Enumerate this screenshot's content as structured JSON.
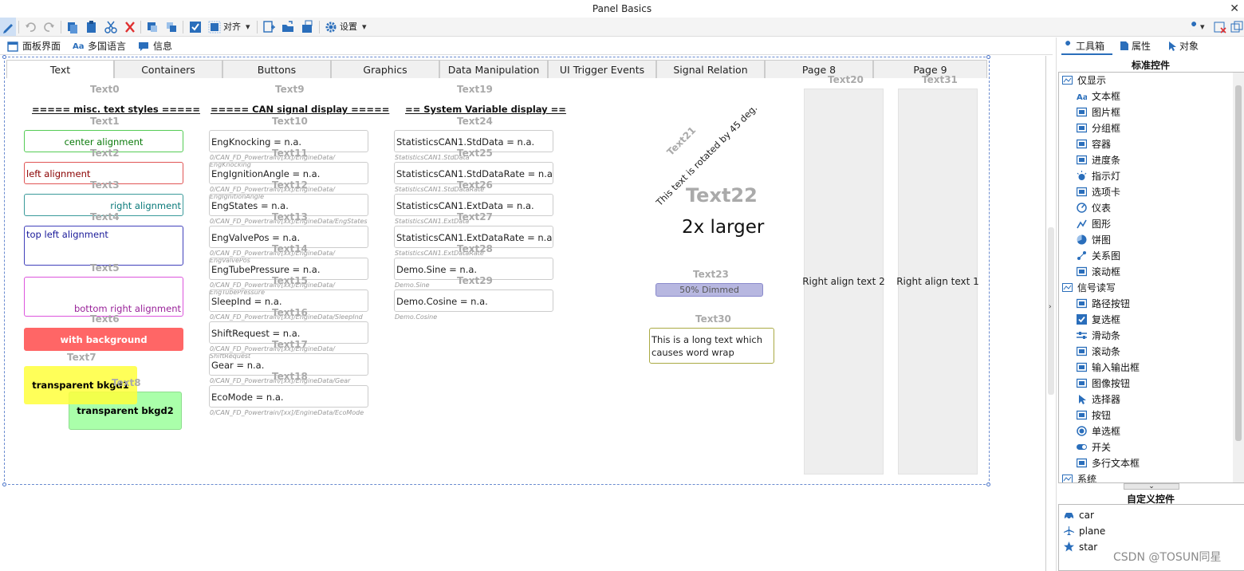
{
  "window": {
    "title": "Panel Basics",
    "close": "✕"
  },
  "toolbar": {
    "align_label": "对齐",
    "settings_label": "设置"
  },
  "panel_tabs": [
    "面板界面",
    "多国语言",
    "信息"
  ],
  "tabs": [
    "Text",
    "Containers",
    "Buttons",
    "Graphics",
    "Data Manipulation",
    "UI Trigger Events",
    "Signal Relation",
    "Page 8",
    "Page 9"
  ],
  "col1": {
    "names": [
      "Text0",
      "Text1",
      "Text2",
      "Text3",
      "Text4",
      "Text5",
      "Text6",
      "Text7",
      "Text8"
    ],
    "header": "===== misc. text styles =====",
    "center": "center alignment",
    "left": "left alignment",
    "right": "right alignment",
    "top_left": "top left alignment",
    "bottom_right": "bottom right alignment",
    "with_bg": "with background",
    "trans1": "transparent bkgd1",
    "trans2": "transparent bkgd2"
  },
  "col2": {
    "title_name": "Text9",
    "header": "===== CAN signal display =====",
    "items": [
      {
        "name": "Text10",
        "value": "EngKnocking = n.a.",
        "sig1": "0/CAN_FD_Powertrain/[xx]/EngineData/",
        "sig2": "EngKnocking"
      },
      {
        "name": "Text11",
        "value": "EngIgnitionAngle = n.a.",
        "sig1": "0/CAN_FD_Powertrain/[xx]/EngineData/",
        "sig2": "EngIgnitionAngle"
      },
      {
        "name": "Text12",
        "value": "EngStates = n.a.",
        "sig1": "0/CAN_FD_Powertrain/[xx]/EngineData/EngStates",
        "sig2": ""
      },
      {
        "name": "Text13",
        "value": "EngValvePos = n.a.",
        "sig1": "0/CAN_FD_Powertrain/[xx]/EngineData/",
        "sig2": "EngValvePos"
      },
      {
        "name": "Text14",
        "value": "EngTubePressure = n.a.",
        "sig1": "0/CAN_FD_Powertrain/[xx]/EngineData/",
        "sig2": "EngTubePressure"
      },
      {
        "name": "Text15",
        "value": "SleepInd = n.a.",
        "sig1": "0/CAN_FD_Powertrain/[xx]/EngineData/SleepInd",
        "sig2": ""
      },
      {
        "name": "Text16",
        "value": "ShiftRequest = n.a.",
        "sig1": "0/CAN_FD_Powertrain/[xx]/EngineData/",
        "sig2": "ShiftRequest"
      },
      {
        "name": "Text17",
        "value": "Gear = n.a.",
        "sig1": "0/CAN_FD_Powertrain/[xx]/EngineData/Gear",
        "sig2": ""
      },
      {
        "name": "Text18",
        "value": "EcoMode = n.a.",
        "sig1": "0/CAN_FD_Powertrain/[xx]/EngineData/EcoMode",
        "sig2": ""
      }
    ]
  },
  "col3": {
    "title_name": "Text19",
    "header": "== System Variable display ==",
    "items": [
      {
        "name": "Text24",
        "value": "StatisticsCAN1.StdData = n.a.",
        "sig": "StatisticsCAN1.StdData"
      },
      {
        "name": "Text25",
        "value": "StatisticsCAN1.StdDataRate = n.a.",
        "sig": "StatisticsCAN1.StdDataRate"
      },
      {
        "name": "Text26",
        "value": "StatisticsCAN1.ExtData = n.a.",
        "sig": "StatisticsCAN1.ExtData"
      },
      {
        "name": "Text27",
        "value": "StatisticsCAN1.ExtDataRate = n.a.",
        "sig": "StatisticsCAN1.ExtDataRate"
      },
      {
        "name": "Text28",
        "value": "Demo.Sine = n.a.",
        "sig": "Demo.Sine"
      },
      {
        "name": "Text29",
        "value": "Demo.Cosine = n.a.",
        "sig": "Demo.Cosine"
      }
    ]
  },
  "misc": {
    "text21_name": "Text21",
    "rotated": "This text is rotated by 45 deg.",
    "text22_name": "Text22",
    "larger": "2x larger",
    "text23_name": "Text23",
    "dimmed": "50% Dimmed",
    "text30_name": "Text30",
    "wrap": "This is a long text which causes word wrap",
    "text20_name": "Text20",
    "right2": "Right align text 2",
    "text31_name": "Text31",
    "right1": "Right align text 1"
  },
  "right_panel": {
    "tabs": [
      "工具箱",
      "属性",
      "对象"
    ],
    "std_header": "标准控件",
    "group_display": "仅显示",
    "display_items": [
      "文本框",
      "图片框",
      "分组框",
      "容器",
      "进度条",
      "指示灯",
      "选项卡",
      "仪表",
      "图形",
      "饼图",
      "关系图",
      "滚动框"
    ],
    "group_signal": "信号读写",
    "signal_items": [
      "路径按钮",
      "复选框",
      "滑动条",
      "滚动条",
      "输入输出框",
      "图像按钮",
      "选择器",
      "按钮",
      "单选框",
      "开关",
      "多行文本框"
    ],
    "group_system": "系统",
    "custom_header": "自定义控件",
    "custom_items": [
      "car",
      "plane",
      "star"
    ]
  },
  "watermark": "CSDN @TOSUN同星",
  "colors": {
    "accent": "#2a6ebb",
    "with_bg": "#ff6666",
    "yellow": "#ffff55",
    "green": "#aaffaa"
  }
}
